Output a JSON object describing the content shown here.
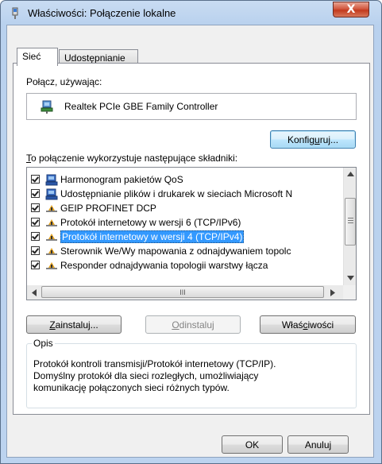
{
  "window": {
    "title": "Właściwości: Połączenie lokalne",
    "close_glyph": "X"
  },
  "tabs": [
    {
      "label": "Sieć",
      "active": true
    },
    {
      "label": "Udostępnianie",
      "active": false
    }
  ],
  "connect_using": {
    "label": "Połącz, używając:",
    "adapter": "Realtek PCIe GBE Family Controller",
    "adapter_icon": "network-adapter-icon"
  },
  "configure_button": {
    "label_pre": "Konfig",
    "label_mnemonic": "u",
    "label_post": "ruj..."
  },
  "components": {
    "label_mnemonic": "T",
    "label_rest": "o połączenie wykorzystuje następujące składniki:",
    "items": [
      {
        "label": "Harmonogram pakietów QoS",
        "checked": true,
        "icon": "service-icon"
      },
      {
        "label": "Udostępnianie plików i drukarek w sieciach Microsoft N",
        "checked": true,
        "icon": "service-icon"
      },
      {
        "label": "GEIP PROFINET DCP",
        "checked": true,
        "icon": "protocol-icon"
      },
      {
        "label": "Protokół internetowy w wersji 6 (TCP/IPv6)",
        "checked": true,
        "icon": "protocol-icon"
      },
      {
        "label": "Protokół internetowy w wersji 4 (TCP/IPv4)",
        "checked": true,
        "icon": "protocol-icon",
        "selected": true
      },
      {
        "label": "Sterownik We/Wy mapowania z odnajdywaniem topolc",
        "checked": true,
        "icon": "protocol-icon"
      },
      {
        "label": "Responder odnajdywania topologii warstwy łącza",
        "checked": true,
        "icon": "protocol-icon"
      }
    ],
    "hscroll_thumb_glyph": "III"
  },
  "buttons": {
    "install": {
      "mnemonic": "Z",
      "rest": "ainstaluj..."
    },
    "uninstall": {
      "mnemonic": "O",
      "rest": "dinstaluj"
    },
    "properties": {
      "pre": "Właś",
      "mnemonic": "c",
      "post": "iwości"
    },
    "ok": "OK",
    "cancel": "Anuluj"
  },
  "description": {
    "legend": "Opis",
    "lines": [
      "Protokół kontroli transmisji/Protokół internetowy (TCP/IP).",
      "Domyślny protokół dla sieci rozległych, umożliwiający",
      "komunikację połączonych sieci różnych typów."
    ]
  },
  "colors": {
    "selection": "#3399ff",
    "close_button": "#c8462c",
    "frame": "#b9d1ee"
  }
}
